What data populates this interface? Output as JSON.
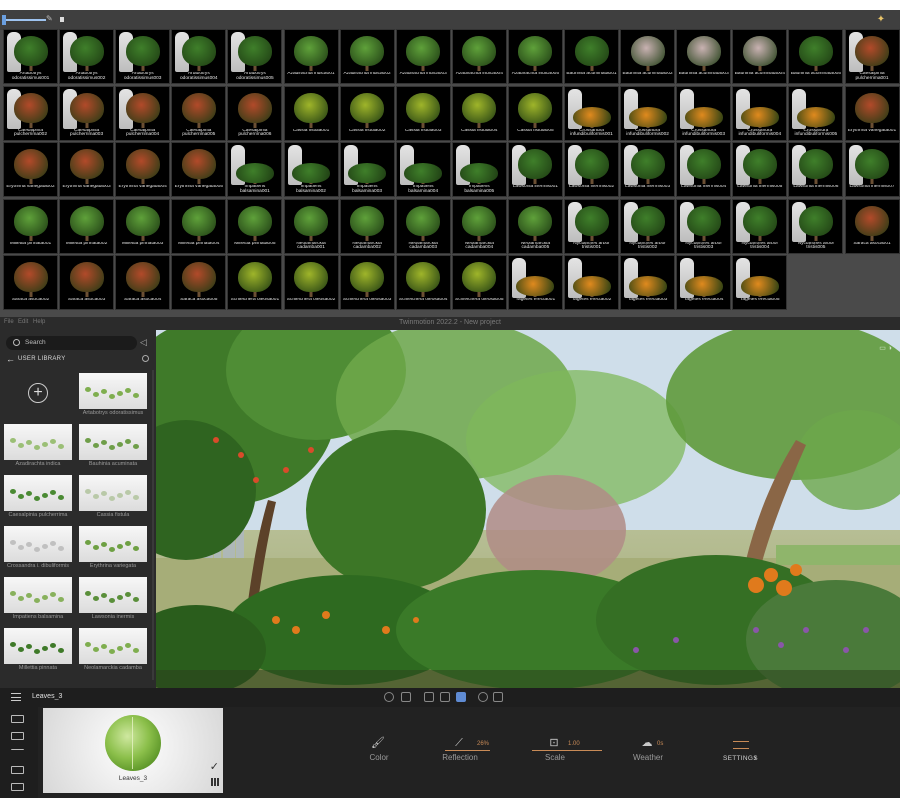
{
  "browser": {
    "cells": [
      [
        "Artabotrys odoratissimus001",
        "Artabotrys odoratissimus002",
        "Artabotrys odoratissimus003",
        "Artabotrys odoratissimus004",
        "Artabotrys odoratissimus005",
        "Azadirachta indica001",
        "Azadirachta indica002",
        "Azadirachta indica003",
        "Azadirachta indica004",
        "Azadirachta indica005",
        "Bauhinia acuminata001",
        "Bauhinia acuminata002",
        "Bauhinia acuminata003",
        "Bauhinia acuminata004",
        "Bauhinia acuminata005",
        "Caesalpinia pulcherrima001"
      ],
      [
        "Caesalpinia pulcherrima002",
        "Caesalpinia pulcherrima003",
        "Caesalpinia pulcherrima004",
        "Caesalpinia pulcherrima005",
        "Caesalpinia pulcherrima006",
        "Cassia fistula001",
        "Cassia fistula002",
        "Cassia fistula003",
        "Cassia fistula004",
        "Cassia fistula005",
        "Crossandra infundibuliformis001",
        "Crossandra infundibuliformis002",
        "Crossandra infundibuliformis003",
        "Crossandra infundibuliformis004",
        "Crossandra infundibuliformis005",
        "Erythrina variegata001"
      ],
      [
        "Erythrina variegata002",
        "Erythrina variegata003",
        "Erythrina variegata004",
        "Erythrina variegata005",
        "Impatiens balsamina001",
        "Impatiens balsamina002",
        "Impatiens balsamina003",
        "Impatiens balsamina004",
        "Impatiens balsamina005",
        "Lawsonia inermis001",
        "Lawsonia inermis002",
        "Lawsonia inermis003",
        "Lawsonia inermis004",
        "Lawsonia inermis005",
        "Lawsonia inermis006",
        "Lawsonia inermis007"
      ],
      [
        "Millettia pinnata001",
        "Millettia pinnata002",
        "Millettia pinnata003",
        "Millettia pinnata004",
        "Millettia pinnata005",
        "Neolamarckia cadamba001",
        "Neolamarckia cadamba002",
        "Neolamarckia cadamba003",
        "Neolamarckia cadamba004",
        "Neolamarckia cadamba005",
        "Nyctanthes arbor tristis001",
        "Nyctanthes arbor tristis002",
        "Nyctanthes arbor tristis003",
        "Nyctanthes arbor tristis004",
        "Nyctanthes arbor tristis005",
        "Saraca asoca001"
      ],
      [
        "Saraca asoca002",
        "Saraca asoca003",
        "Saraca asoca004",
        "Saraca asoca005",
        "Schleichera oleosa001",
        "Schleichera oleosa002",
        "Schleichera oleosa003",
        "Schleichera oleosa004",
        "Schleichera oleosa005",
        "Tagetes erecta001",
        "Tagetes erecta002",
        "Tagetes erecta003",
        "Tagetes erecta004",
        "Tagetes erecta005"
      ]
    ],
    "colors": {
      "tree": "#3f7f2a",
      "bright": "#5fa13a",
      "yellow": "#9fb52a",
      "red": "#b24a2a",
      "pink": "#c9b2b2",
      "marigold": "#e08a1e"
    }
  },
  "app": {
    "title": "Twinmotion 2022.2 - New project",
    "menu": [
      "File",
      "Edit",
      "Help"
    ]
  },
  "library": {
    "search_placeholder": "Search",
    "heading": "USER LIBRARY",
    "items": [
      "Artabotrys odoratissimus",
      "Azadirachta indica",
      "Bauhinia acuminata",
      "Caesalpinia pulcherrima",
      "Cassia fistula",
      "Crossandra i. dibuliformis",
      "Erythrina variegata",
      "Impatiens balsamina",
      "Lawsonia inermis",
      "Millettia pinnata",
      "Neolamarckia cadamba"
    ]
  },
  "toolbar": {
    "material_name": "Leaves_3"
  },
  "material": {
    "preview_label": "Leaves_3",
    "properties": [
      {
        "label": "Color",
        "value": ""
      },
      {
        "label": "Reflection",
        "value": "26%"
      },
      {
        "label": "Scale",
        "value": "1.00"
      },
      {
        "label": "Weather",
        "value": "0s"
      }
    ],
    "settings_label": "SETTINGS"
  }
}
